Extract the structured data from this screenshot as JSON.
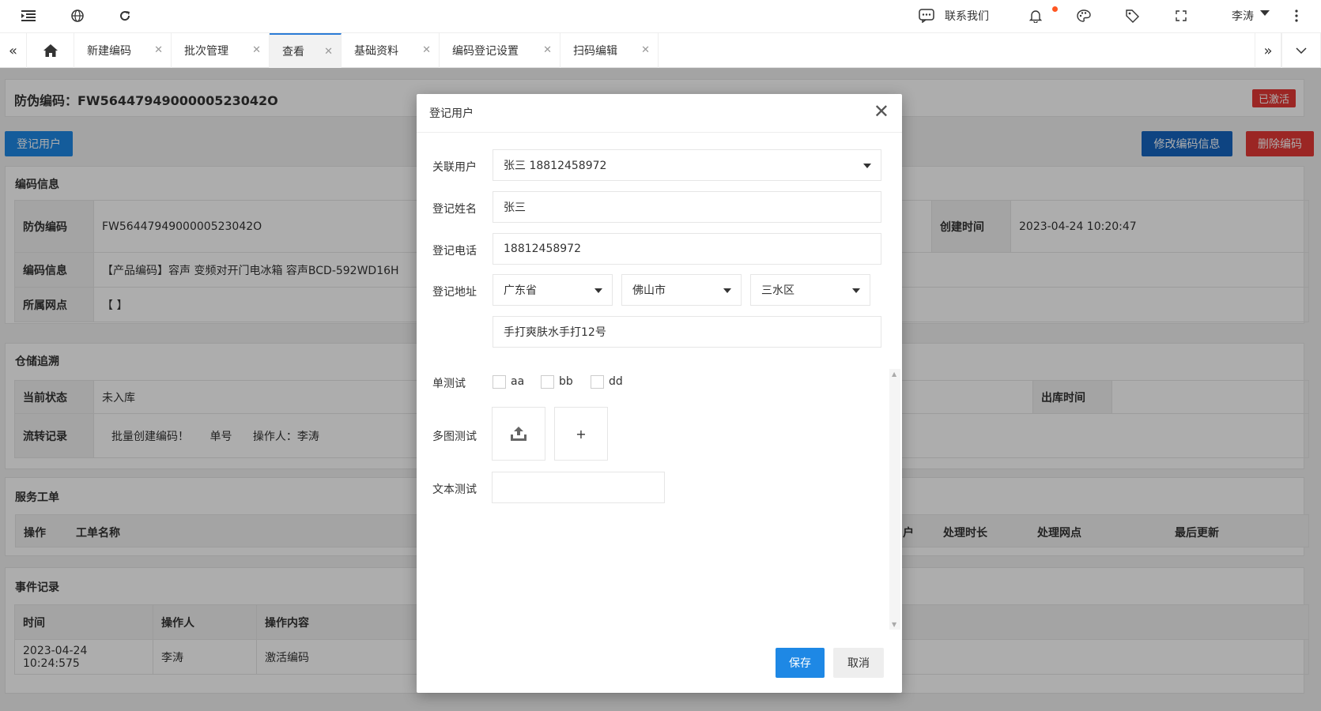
{
  "header": {
    "contact_label": "联系我们",
    "user_name": "李涛"
  },
  "tabs": [
    {
      "label": "新建编码"
    },
    {
      "label": "批次管理"
    },
    {
      "label": "查看"
    },
    {
      "label": "基础资料"
    },
    {
      "label": "编码登记设置"
    },
    {
      "label": "扫码编辑"
    }
  ],
  "page": {
    "code_title": "防伪编码：FW5644794900000523042O",
    "status_badge": "已激活",
    "register_btn": "登记用户",
    "edit_btn": "修改编码信息",
    "delete_btn": "删除编码",
    "code_info": {
      "title": "编码信息",
      "code_label": "防伪编码",
      "code_value": "FW5644794900000523042O",
      "created_label": "创建时间",
      "created_value": "2023-04-24 10:20:47",
      "info_label": "编码信息",
      "info_value": "【产品编码】容声 变频对开门电冰箱 容声BCD-592WD16H",
      "network_label": "所属网点",
      "network_value": "【 】"
    },
    "storage": {
      "title": "仓储追溯",
      "status_label": "当前状态",
      "status_value": "未入库",
      "outbound_label": "出库时间",
      "flow_label": "流转记录",
      "flow_text": "批量创建编码！",
      "flow_order": "单号",
      "flow_operator": "操作人：李涛"
    },
    "service": {
      "title": "服务工单",
      "col_action": "操作",
      "col_name": "工单名称",
      "col_partial": "户",
      "col_duration": "处理时长",
      "col_network": "处理网点",
      "col_updated": "最后更新"
    },
    "events": {
      "title": "事件记录",
      "col_time": "时间",
      "col_operator": "操作人",
      "col_content": "操作内容",
      "row_time": "2023-04-24 10:24:575",
      "row_operator": "李涛",
      "row_content": "激活编码"
    }
  },
  "modal": {
    "title": "登记用户",
    "linked_user_label": "关联用户",
    "linked_user_value": "张三 18812458972",
    "name_label": "登记姓名",
    "name_value": "张三",
    "phone_label": "登记电话",
    "phone_value": "18812458972",
    "address_label": "登记地址",
    "province": "广东省",
    "city": "佛山市",
    "district": "三水区",
    "street": "手打爽肤水手打12号",
    "single_test_label": "单测试",
    "options": [
      "aa",
      "bb",
      "dd"
    ],
    "multi_image_label": "多图测试",
    "add_symbol": "+",
    "text_test_label": "文本测试",
    "save_btn": "保存",
    "cancel_btn": "取消"
  },
  "colors": {
    "primary": "#1e88e5",
    "danger": "#e53935",
    "save": "#1e88e5"
  }
}
